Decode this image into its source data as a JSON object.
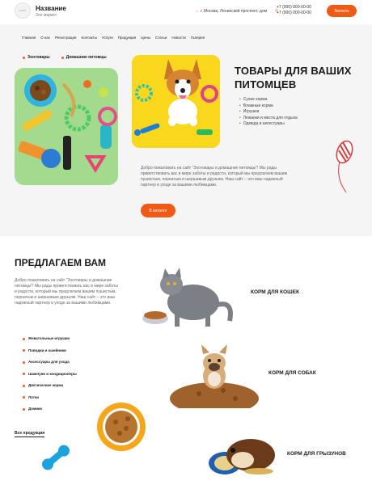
{
  "header": {
    "logo_text": "LOGO",
    "site_name": "Название",
    "site_sub": "Зоо маркет",
    "address": "г. Москва, Ленинский проспект, дом",
    "phone1": "+7 (000) 000-00-00",
    "phone2": "+7 (000) 000-00-00",
    "call_button": "Звонить"
  },
  "nav": [
    "Главная",
    "О нас",
    "Регистрация",
    "Контакты",
    "Услуги",
    "Продукция",
    "Цены",
    "Статьи",
    "Новости",
    "Галерея"
  ],
  "hero": {
    "links": [
      "Зоотовары",
      "Домашние питомцы"
    ],
    "title": "ТОВАРЫ ДЛЯ ВАШИХ ПИТОМЦЕВ",
    "list": [
      "Сухие корма",
      "Влажные корма",
      "Игрушки",
      "Лежанки и места для отдыха",
      "Одежда и аксессуары"
    ],
    "text": "Добро пожаловать на сайт \"Зоотовары и домашние питомцы\"! Мы рады приветствовать вас в мире заботы и радости, который мы предлагаем вашим пушистым, пернатым и шершавым друзьям. Наш сайт – это ваш надежный партнер в уходе за вашими любимцами.",
    "button": "В каталог"
  },
  "offers": {
    "title": "ПРЕДЛАГАЕМ ВАМ",
    "text": "Добро пожаловать на сайт \"Зоотовары и домашние питомцы\"! Мы рады приветствовать вас в мире заботы и радости, который мы предлагаем вашим пушистым, пернатым и шершавым друзьям. Наш сайт – это ваш надежный партнер в уходе за вашими любимцами.",
    "categories": [
      "Жевательные игрушки",
      "Поводки и ошейники",
      "Аксессуары для ухода",
      "Шампуни и кондиционеры",
      "Диетические корма",
      "Лотки",
      "Домики"
    ],
    "all_products": "Все продукция",
    "card_cat": "КОРМ ДЛЯ КОШЕК",
    "card_dog": "КОРМ ДЛЯ СОБАК",
    "card_rodent": "КОРМ ДЛЯ ГРЫЗУНОВ"
  },
  "colors": {
    "accent": "#f05a14",
    "hero_bg": "#f5f5f5"
  }
}
